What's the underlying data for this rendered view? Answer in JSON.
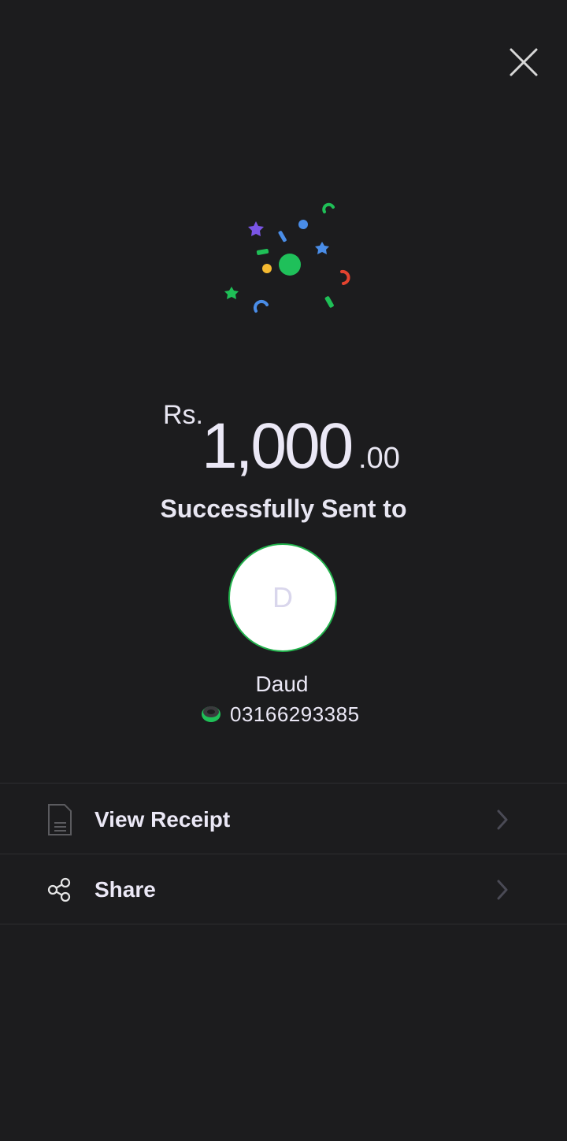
{
  "app": {
    "close_icon": "close-icon",
    "confetti_icon": "confetti-icon"
  },
  "transaction": {
    "currency": "Rs.",
    "amount_whole": "1,000",
    "amount_decimals": ".00",
    "status_text": "Successfully Sent to"
  },
  "recipient": {
    "initial": "D",
    "name": "Daud",
    "number": "03166293385",
    "wallet_icon": "wallet-logo-icon"
  },
  "actions": [
    {
      "label": "View Receipt",
      "icon": "receipt-icon"
    },
    {
      "label": "Share",
      "icon": "share-icon"
    }
  ],
  "colors": {
    "background": "#1c1c1e",
    "accent_green": "#22b24c",
    "text": "#ebe8f6",
    "divider": "#2e2e31"
  }
}
